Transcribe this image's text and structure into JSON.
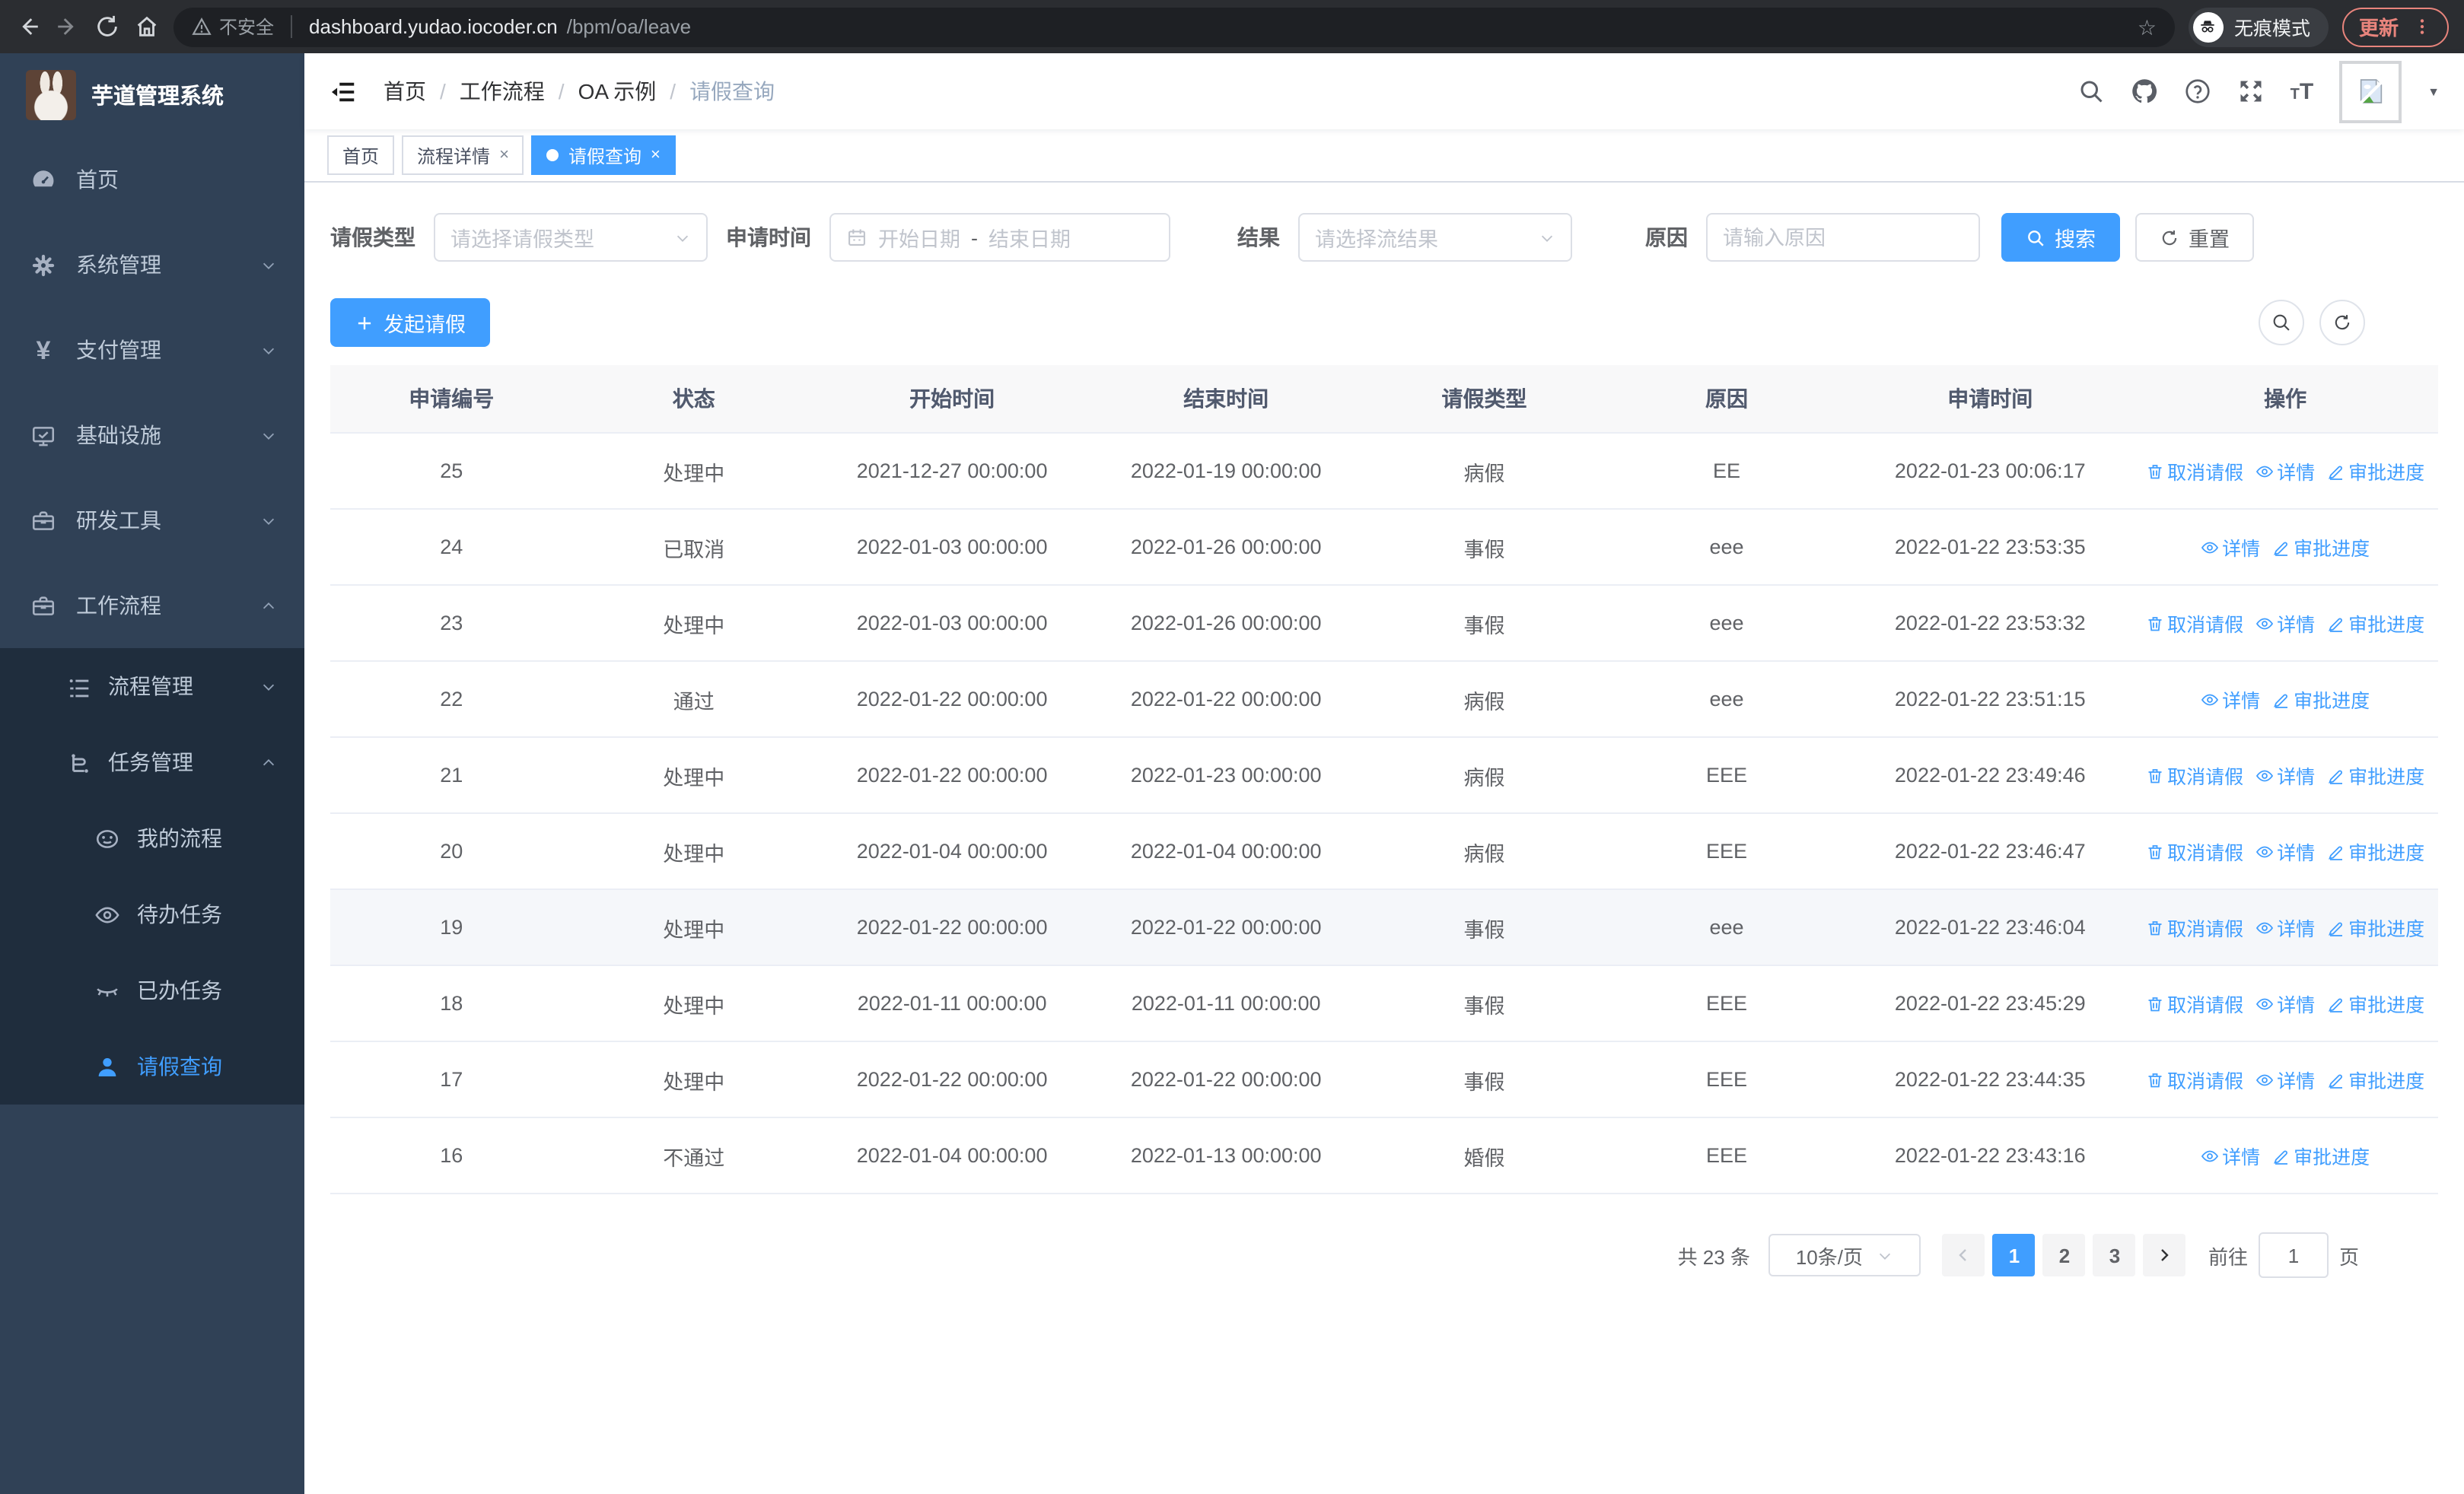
{
  "browser": {
    "security_label": "不安全",
    "url_host": "dashboard.yudao.iocoder.cn",
    "url_path": "/bpm/oa/leave",
    "incognito_label": "无痕模式",
    "update_label": "更新",
    "star_glyph": "☆"
  },
  "ui": {
    "close_glyph": "×",
    "caret_glyph": "▼"
  },
  "colors": {
    "accent": "#409eff",
    "sidebar_bg": "#304156",
    "submenu_bg": "#1f2d3d",
    "update_accent": "#e8847c"
  },
  "sidebar": {
    "title": "芋道管理系统",
    "items": [
      {
        "label": "首页",
        "icon": "dashboard-icon"
      },
      {
        "label": "系统管理",
        "icon": "gear-icon"
      },
      {
        "label": "支付管理",
        "icon": "yen-icon"
      },
      {
        "label": "基础设施",
        "icon": "monitor-icon"
      },
      {
        "label": "研发工具",
        "icon": "briefcase-icon"
      },
      {
        "label": "工作流程",
        "icon": "briefcase-icon"
      }
    ],
    "submenu": {
      "groups": [
        {
          "label": "流程管理",
          "icon": "list-icon"
        },
        {
          "label": "任务管理",
          "icon": "tree-icon"
        }
      ],
      "children": [
        {
          "label": "我的流程",
          "icon": "robot-face-icon"
        },
        {
          "label": "待办任务",
          "icon": "eye-open-icon"
        },
        {
          "label": "已办任务",
          "icon": "eye-closed-icon"
        },
        {
          "label": "请假查询",
          "icon": "person-icon"
        }
      ]
    }
  },
  "navbar": {
    "breadcrumb": {
      "items": [
        "首页",
        "工作流程",
        "OA 示例",
        "请假查询"
      ],
      "separator": "/"
    }
  },
  "tabs": [
    {
      "label": "首页"
    },
    {
      "label": "流程详情"
    },
    {
      "label": "请假查询"
    }
  ],
  "filters": {
    "type_label": "请假类型",
    "type_placeholder": "请选择请假类型",
    "time_label": "申请时间",
    "start_placeholder": "开始日期",
    "range_separator": "-",
    "end_placeholder": "结束日期",
    "result_label": "结果",
    "result_placeholder": "请选择流结果",
    "reason_label": "原因",
    "reason_placeholder": "请输入原因",
    "search_label": "搜索",
    "reset_label": "重置"
  },
  "toolbar": {
    "create_label": "发起请假"
  },
  "table": {
    "columns": [
      "申请编号",
      "状态",
      "开始时间",
      "结束时间",
      "请假类型",
      "原因",
      "申请时间",
      "操作"
    ],
    "action_labels": {
      "cancel": "取消请假",
      "detail": "详情",
      "progress": "审批进度"
    },
    "rows": [
      {
        "id": "25",
        "status": "处理中",
        "start": "2021-12-27 00:00:00",
        "end": "2022-01-19 00:00:00",
        "type": "病假",
        "reason": "EE",
        "applied": "2022-01-23 00:06:17",
        "actions": [
          "cancel",
          "detail",
          "progress"
        ]
      },
      {
        "id": "24",
        "status": "已取消",
        "start": "2022-01-03 00:00:00",
        "end": "2022-01-26 00:00:00",
        "type": "事假",
        "reason": "eee",
        "applied": "2022-01-22 23:53:35",
        "actions": [
          "detail",
          "progress"
        ]
      },
      {
        "id": "23",
        "status": "处理中",
        "start": "2022-01-03 00:00:00",
        "end": "2022-01-26 00:00:00",
        "type": "事假",
        "reason": "eee",
        "applied": "2022-01-22 23:53:32",
        "actions": [
          "cancel",
          "detail",
          "progress"
        ]
      },
      {
        "id": "22",
        "status": "通过",
        "start": "2022-01-22 00:00:00",
        "end": "2022-01-22 00:00:00",
        "type": "病假",
        "reason": "eee",
        "applied": "2022-01-22 23:51:15",
        "actions": [
          "detail",
          "progress"
        ]
      },
      {
        "id": "21",
        "status": "处理中",
        "start": "2022-01-22 00:00:00",
        "end": "2022-01-23 00:00:00",
        "type": "病假",
        "reason": "EEE",
        "applied": "2022-01-22 23:49:46",
        "actions": [
          "cancel",
          "detail",
          "progress"
        ]
      },
      {
        "id": "20",
        "status": "处理中",
        "start": "2022-01-04 00:00:00",
        "end": "2022-01-04 00:00:00",
        "type": "病假",
        "reason": "EEE",
        "applied": "2022-01-22 23:46:47",
        "actions": [
          "cancel",
          "detail",
          "progress"
        ]
      },
      {
        "id": "19",
        "status": "处理中",
        "start": "2022-01-22 00:00:00",
        "end": "2022-01-22 00:00:00",
        "type": "事假",
        "reason": "eee",
        "applied": "2022-01-22 23:46:04",
        "actions": [
          "cancel",
          "detail",
          "progress"
        ],
        "highlight": true
      },
      {
        "id": "18",
        "status": "处理中",
        "start": "2022-01-11 00:00:00",
        "end": "2022-01-11 00:00:00",
        "type": "事假",
        "reason": "EEE",
        "applied": "2022-01-22 23:45:29",
        "actions": [
          "cancel",
          "detail",
          "progress"
        ]
      },
      {
        "id": "17",
        "status": "处理中",
        "start": "2022-01-22 00:00:00",
        "end": "2022-01-22 00:00:00",
        "type": "事假",
        "reason": "EEE",
        "applied": "2022-01-22 23:44:35",
        "actions": [
          "cancel",
          "detail",
          "progress"
        ]
      },
      {
        "id": "16",
        "status": "不通过",
        "start": "2022-01-04 00:00:00",
        "end": "2022-01-13 00:00:00",
        "type": "婚假",
        "reason": "EEE",
        "applied": "2022-01-22 23:43:16",
        "actions": [
          "detail",
          "progress"
        ]
      }
    ]
  },
  "pagination": {
    "total_label": "共 23 条",
    "page_size_label": "10条/页",
    "pages": [
      "1",
      "2",
      "3"
    ],
    "active_page": "1",
    "goto_label": "前往",
    "goto_value": "1",
    "unit_label": "页"
  }
}
